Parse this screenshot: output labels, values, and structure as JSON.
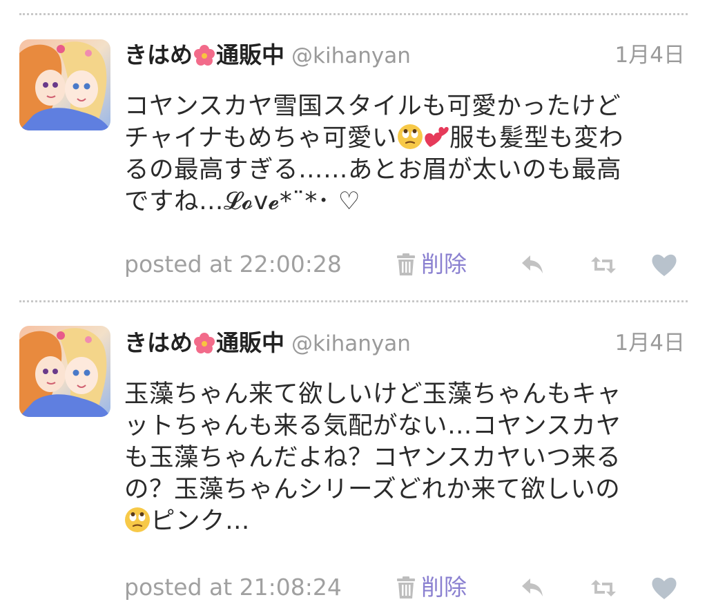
{
  "tweets": [
    {
      "user": {
        "name_prefix": "きはめ",
        "name_suffix": "通販中",
        "name_icon": "hibiscus-icon",
        "handle": "@kihanyan"
      },
      "date": "1月4日",
      "lines": [
        "コヤンスカヤ雪国スタイルも可愛かったけど",
        [
          "チャイナもめちゃ可愛い",
          "服も髪型も変わ"
        ],
        "るの最高すぎる……あとお眉が太いのも最高",
        "ですね…𝓛𝓸ⅴ𝓮*¨*･ ♡"
      ],
      "emojis": [
        "rolling-eyes-emoji",
        "two-hearts-emoji"
      ],
      "posted": "posted at 22:00:28",
      "delete_label": "削除"
    },
    {
      "user": {
        "name_prefix": "きはめ",
        "name_suffix": "通販中",
        "name_icon": "hibiscus-icon",
        "handle": "@kihanyan"
      },
      "date": "1月4日",
      "lines": [
        "玉藻ちゃん来て欲しいけど玉藻ちゃんもキャ",
        "ットちゃんも来る気配がない…コヤンスカヤ",
        "も玉藻ちゃんだよね？コヤンスカヤいつ来る",
        "の？玉藻ちゃんシリーズどれか来て欲しいの",
        [
          "",
          "ピンク…"
        ]
      ],
      "emojis": [
        "rolling-eyes-emoji"
      ],
      "posted": "posted at 21:08:24",
      "delete_label": "削除"
    }
  ],
  "colors": {
    "divider": "#c8c8c8",
    "delete_text": "#8a80d0",
    "action_icon": "#c2c2c2",
    "like_icon": "#b8c2cc"
  }
}
